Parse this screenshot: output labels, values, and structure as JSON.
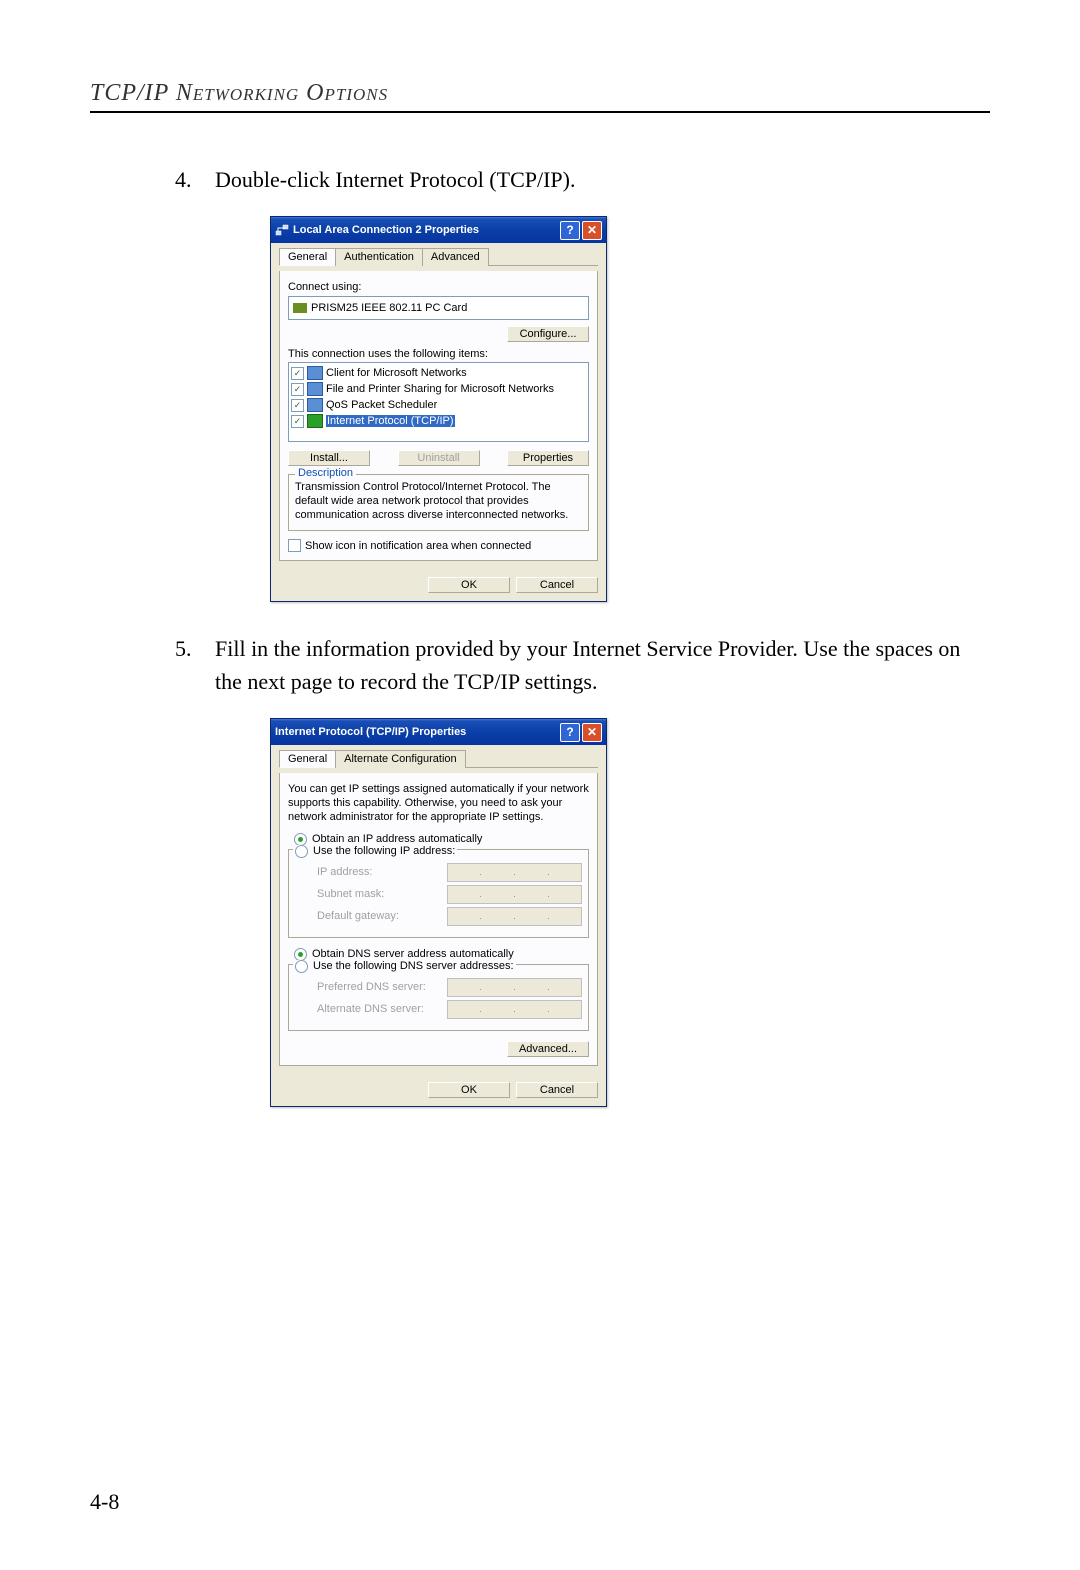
{
  "header": "TCP/IP Networking Options",
  "steps": {
    "s4": {
      "num": "4.",
      "text": "Double-click Internet Protocol (TCP/IP)."
    },
    "s5": {
      "num": "5.",
      "text": "Fill in the information provided by your Internet Service Provider. Use the spaces on the next page to record the TCP/IP settings."
    }
  },
  "dlg1": {
    "title": "Local Area Connection 2 Properties",
    "tabs": {
      "general": "General",
      "auth": "Authentication",
      "adv": "Advanced"
    },
    "connect_using_label": "Connect using:",
    "adapter": "PRISM25 IEEE 802.11 PC Card",
    "configure": "Configure...",
    "items_label": "This connection uses the following items:",
    "items": [
      "Client for Microsoft Networks",
      "File and Printer Sharing for Microsoft Networks",
      "QoS Packet Scheduler",
      "Internet Protocol (TCP/IP)"
    ],
    "install": "Install...",
    "uninstall": "Uninstall",
    "properties": "Properties",
    "desc_legend": "Description",
    "desc_text": "Transmission Control Protocol/Internet Protocol. The default wide area network protocol that provides communication across diverse interconnected networks.",
    "show_icon": "Show icon in notification area when connected",
    "ok": "OK",
    "cancel": "Cancel"
  },
  "dlg2": {
    "title": "Internet Protocol (TCP/IP) Properties",
    "tabs": {
      "general": "General",
      "alt": "Alternate Configuration"
    },
    "intro": "You can get IP settings assigned automatically if your network supports this capability. Otherwise, you need to ask your network administrator for the appropriate IP settings.",
    "r_auto_ip": "Obtain an IP address automatically",
    "r_use_ip": "Use the following IP address:",
    "ip_label": "IP address:",
    "subnet_label": "Subnet mask:",
    "gateway_label": "Default gateway:",
    "r_auto_dns": "Obtain DNS server address automatically",
    "r_use_dns": "Use the following DNS server addresses:",
    "pref_dns": "Preferred DNS server:",
    "alt_dns": "Alternate DNS server:",
    "advanced": "Advanced...",
    "ok": "OK",
    "cancel": "Cancel"
  },
  "pagenum": "4-8"
}
